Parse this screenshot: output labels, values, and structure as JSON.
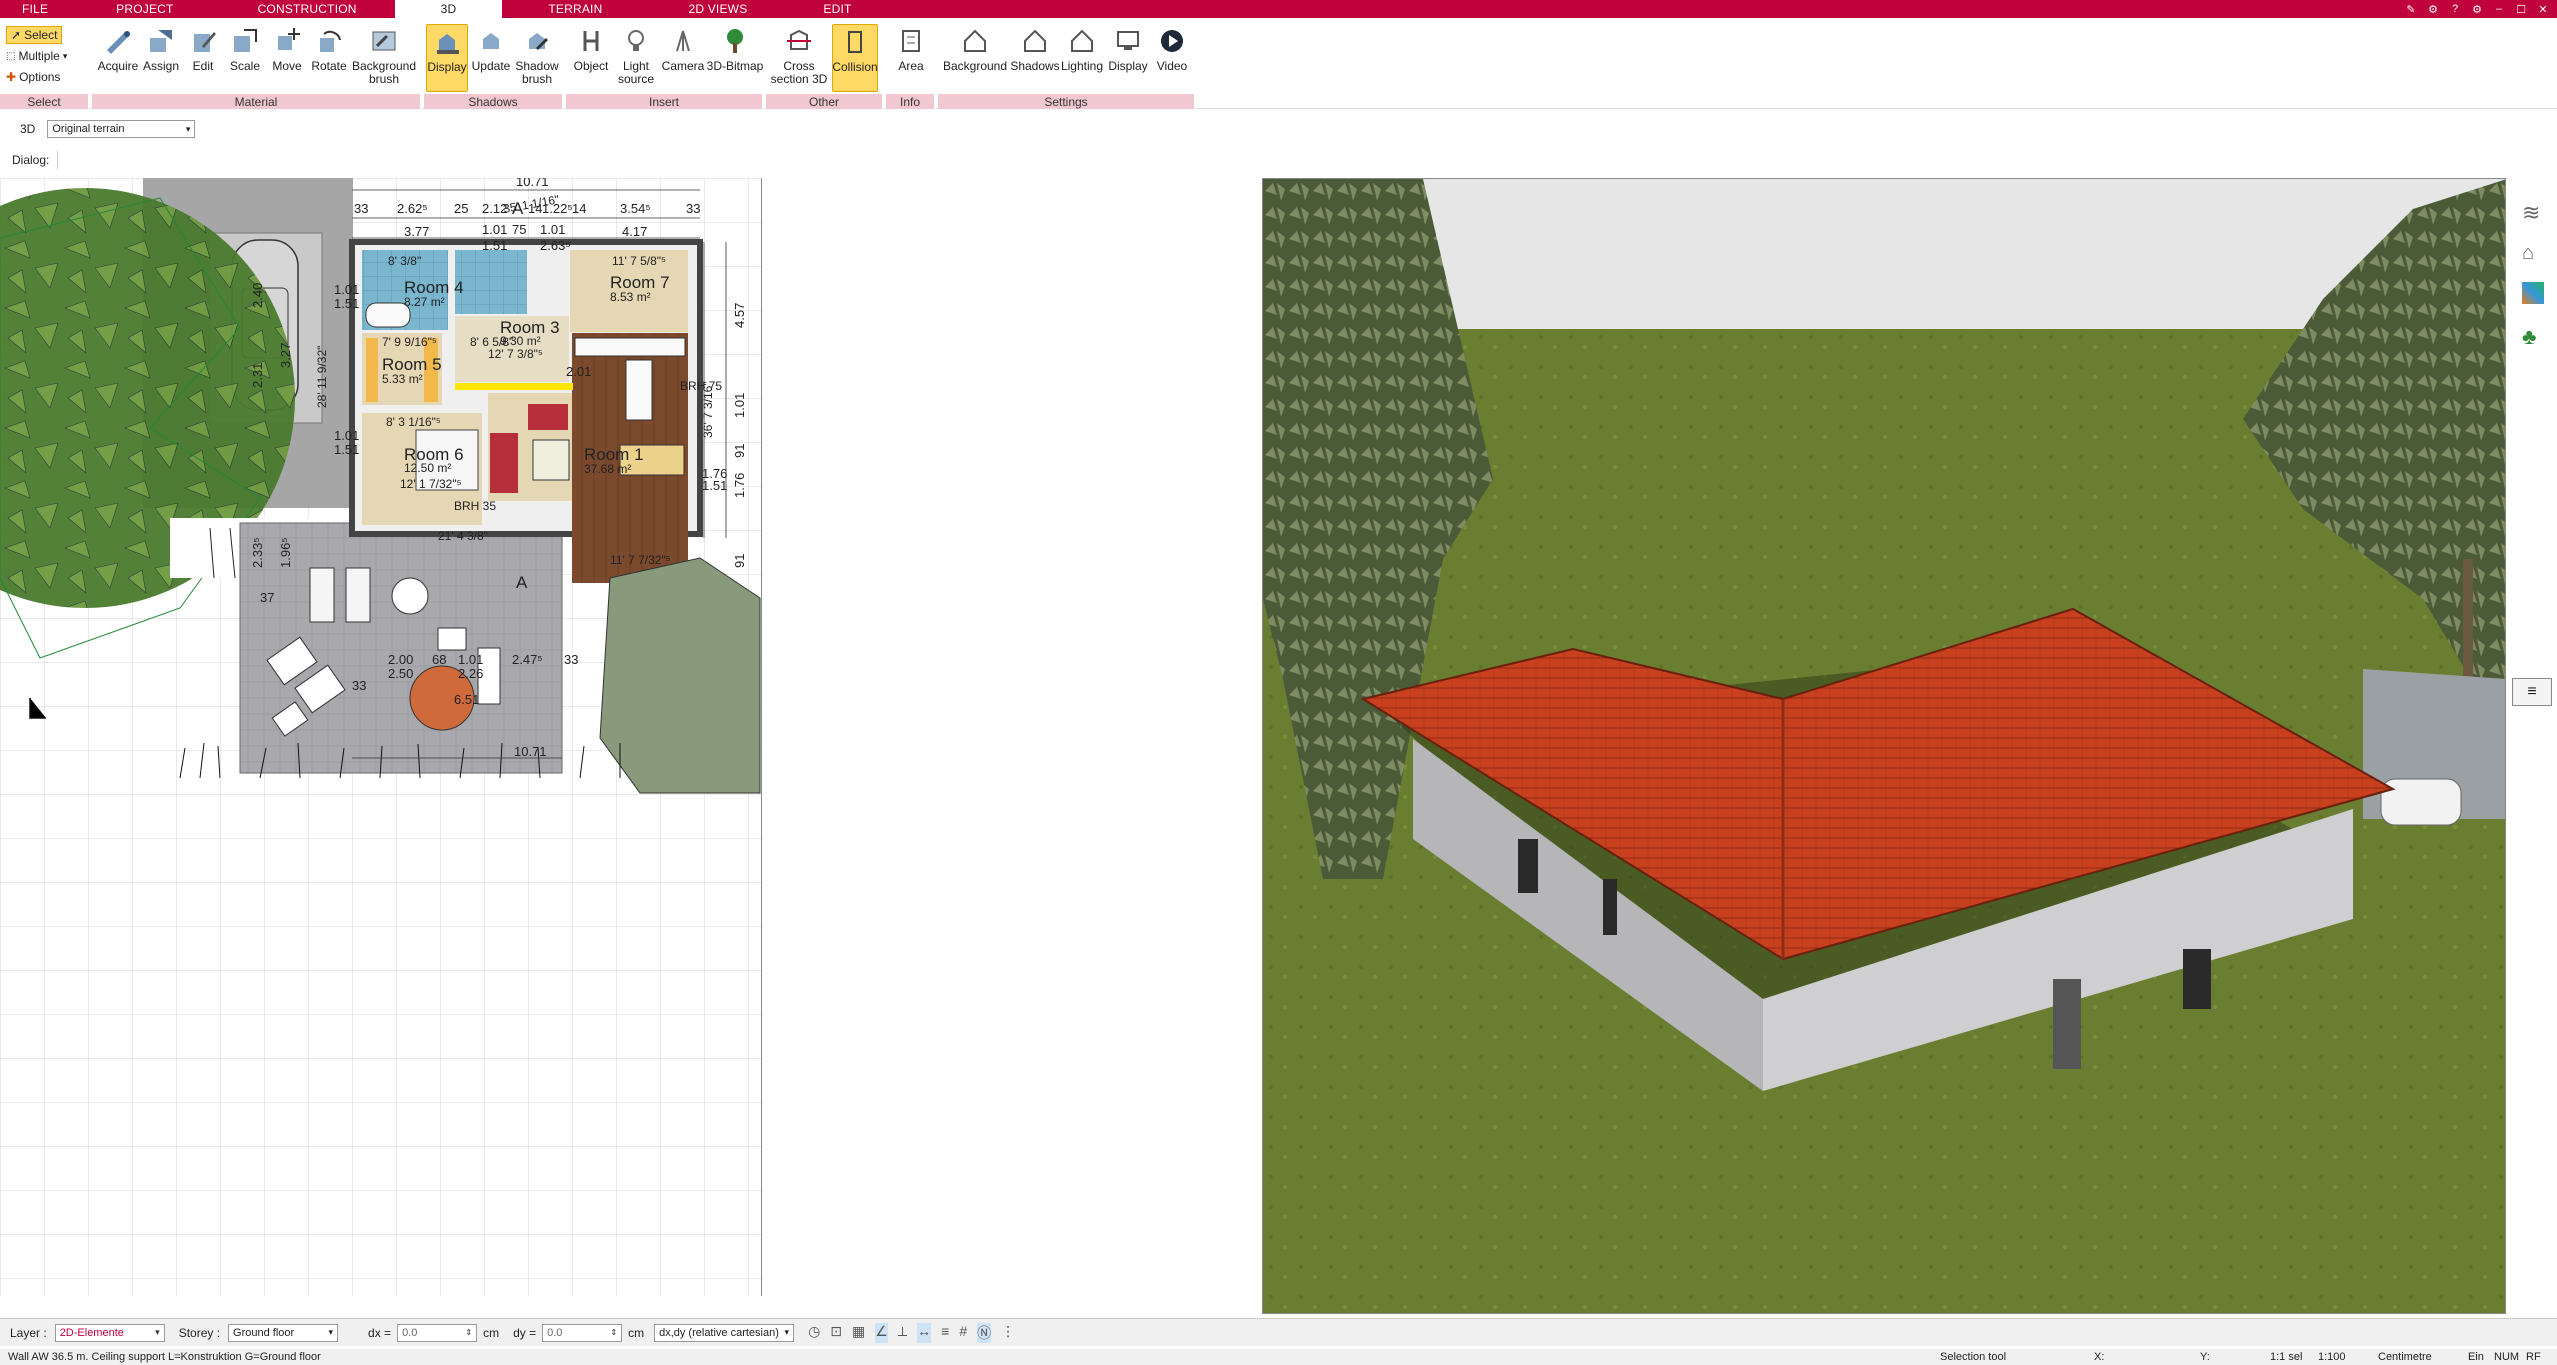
{
  "menu": {
    "tabs": [
      "FILE",
      "PROJECT",
      "CONSTRUCTION",
      "3D",
      "TERRAIN",
      "2D VIEWS",
      "EDIT"
    ],
    "active": "3D"
  },
  "ribbon": {
    "select_group": {
      "select": "Select",
      "multiple": "Multiple",
      "options": "Options",
      "label": "Select"
    },
    "material_group": {
      "label": "Material",
      "buttons": [
        "Acquire",
        "Assign",
        "Edit",
        "Scale",
        "Move",
        "Rotate",
        "Background brush"
      ]
    },
    "shadows_group": {
      "label": "Shadows",
      "buttons": [
        "Display",
        "Update",
        "Shadow brush"
      ]
    },
    "insert_group": {
      "label": "Insert",
      "buttons": [
        "Object",
        "Light source",
        "Camera",
        "3D-Bitmap"
      ]
    },
    "other_group": {
      "label": "Other",
      "buttons": [
        "Cross section 3D",
        "Collision"
      ]
    },
    "info_group": {
      "label": "Info",
      "buttons": [
        "Area"
      ]
    },
    "settings_group": {
      "label": "Settings",
      "buttons": [
        "Background",
        "Shadows",
        "Lighting",
        "Display",
        "Video"
      ]
    }
  },
  "row3d": {
    "mode": "3D",
    "terrain": "Original terrain"
  },
  "dialog": {
    "label": "Dialog:"
  },
  "plan": {
    "rooms": [
      {
        "name": "Room 4",
        "area": "8.27 m²"
      },
      {
        "name": "Room 7",
        "area": "8.53 m²"
      },
      {
        "name": "Room 3",
        "area": "9.30 m²"
      },
      {
        "name": "Room 5",
        "area": "5.33 m²"
      },
      {
        "name": "Room 6",
        "area": "12.50 m²"
      },
      {
        "name": "Room 1",
        "area": "37.68 m²"
      }
    ],
    "dimensions": {
      "top_total": "10.71",
      "bottom_total": "10.71",
      "top_row": [
        "33",
        "2.62⁵",
        "25",
        "2.12",
        "14",
        "1.22⁵",
        "14",
        "3.54⁵",
        "33"
      ],
      "second_row": [
        "3.77",
        "1.01",
        "75",
        "1.01",
        "4.17"
      ],
      "third_row": [
        "1.51",
        "2.63⁵"
      ],
      "right_col": [
        "4.57",
        "1.01",
        "91",
        "1.76",
        "91"
      ],
      "left_col": [
        "1.01",
        "1.51",
        "2.31",
        "3.27",
        "2.40",
        "1.01",
        "1.51"
      ],
      "terrace": [
        "2.00",
        "2.50",
        "68",
        "1.01",
        "2.26",
        "2.47⁵",
        "33",
        "33",
        "1.96⁵",
        "2.33⁵",
        "37"
      ],
      "imperial": [
        "11' 7 5/8\"⁵",
        "8' 3/8\"",
        "12' 7 3/8\"⁵",
        "8' 6 5/8\"",
        "7' 9 9/16\"⁵",
        "8' 3 1/16\"⁵",
        "12' 1 7/32\"⁵",
        "11' 7 7/32\"⁵",
        "21' 4 3/8\"",
        "28' 11 9/32\"",
        "36' 7 3/16\"",
        "35' 1 1/16\""
      ],
      "misc": [
        "6.51",
        "1.76",
        "1.51",
        "2.01",
        "BRH 75",
        "BRH 35"
      ]
    },
    "section_marks": [
      "A",
      "A"
    ]
  },
  "status": {
    "layer_label": "Layer :",
    "layer_value": "2D-Elemente",
    "storey_label": "Storey :",
    "storey_value": "Ground floor",
    "dx_label": "dx =",
    "dx_value": "0.0",
    "dy_label": "dy =",
    "dy_value": "0.0",
    "unit": "cm",
    "coord_mode": "dx,dy (relative cartesian)"
  },
  "footer": {
    "message": "Wall AW 36.5 m. Ceiling support L=Konstruktion G=Ground floor",
    "tool": "Selection tool",
    "x": "X:",
    "y": "Y:",
    "scale1": "1:1 sel",
    "scale2": "1:100",
    "unit": "Centimetre",
    "mode1": "Ein",
    "mode2": "NUM",
    "mode3": "RF"
  },
  "colors": {
    "brand": "#c0003a",
    "ribbon_group": "#f1c8d2",
    "active_btn": "#ffd966",
    "roof": "#c8401e",
    "grass": "#6a7e32",
    "sky": "#e6e6e6"
  }
}
